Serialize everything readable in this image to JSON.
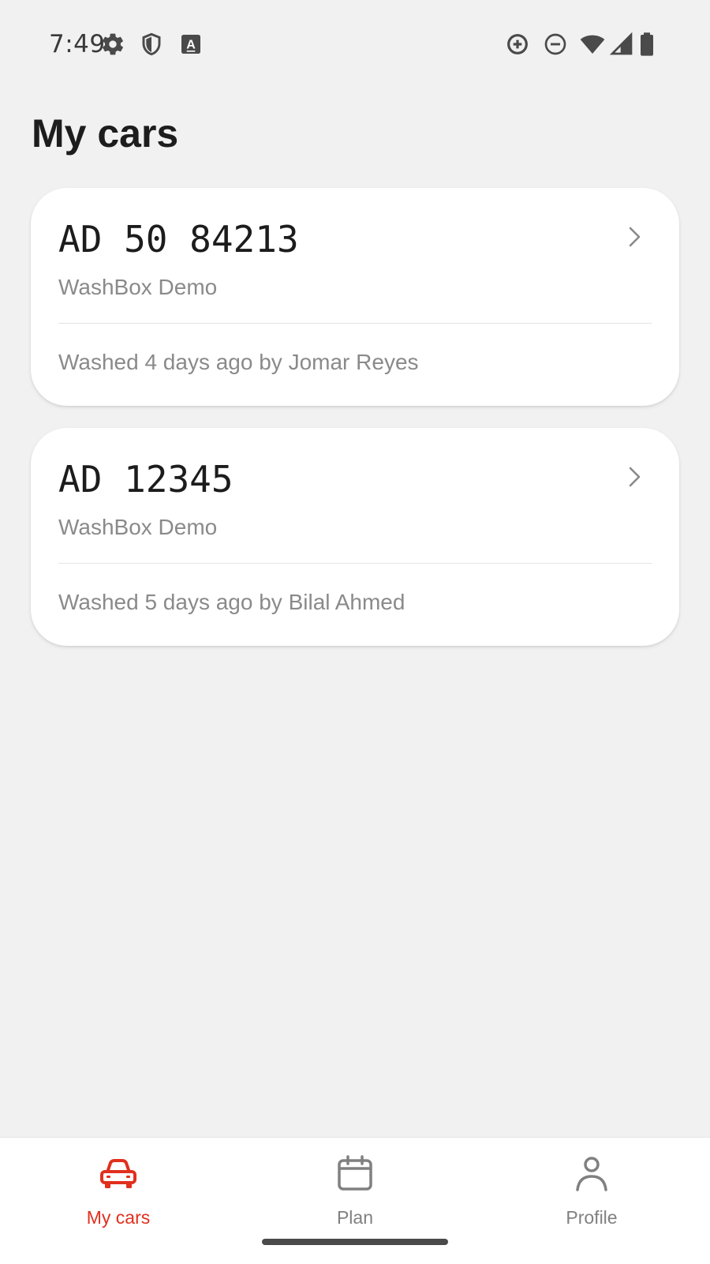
{
  "status_bar": {
    "time": "7:49",
    "left_icons": [
      "gear-icon",
      "shield-icon",
      "keyboard-a-icon"
    ],
    "right_icons": [
      "data-saver-icon",
      "do-not-disturb-icon",
      "wifi-icon",
      "signal-icon",
      "battery-icon"
    ]
  },
  "page": {
    "title": "My cars"
  },
  "cars": [
    {
      "plate": "AD 50 84213",
      "company": "WashBox Demo",
      "last_wash": "Washed 4 days ago by Jomar Reyes"
    },
    {
      "plate": "AD 12345",
      "company": "WashBox Demo",
      "last_wash": "Washed 5 days ago by Bilal Ahmed"
    }
  ],
  "bottom_nav": {
    "items": [
      {
        "label": "My cars",
        "icon": "car-icon",
        "active": true
      },
      {
        "label": "Plan",
        "icon": "calendar-icon",
        "active": false
      },
      {
        "label": "Profile",
        "icon": "person-icon",
        "active": false
      }
    ]
  },
  "colors": {
    "accent": "#e0301e",
    "background": "#f1f1f1",
    "card": "#ffffff",
    "muted_text": "#8a8a8a",
    "title_text": "#1d1d1d"
  }
}
